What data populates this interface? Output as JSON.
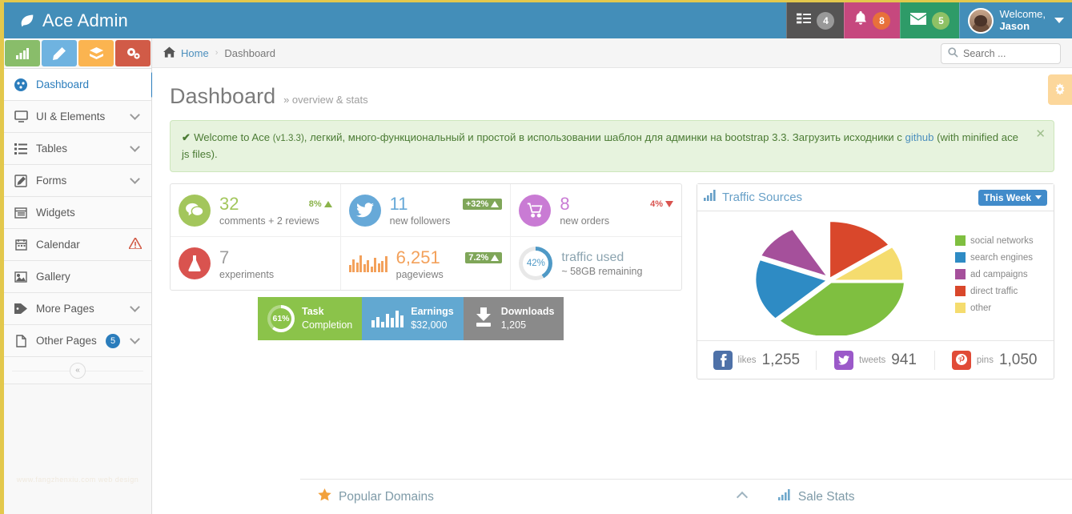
{
  "navbar": {
    "brand": "Ace Admin",
    "brand_icon": "leaf-icon",
    "tasks": {
      "icon": "tasks-icon",
      "count": "4"
    },
    "notifications": {
      "icon": "bell-icon",
      "count": "8"
    },
    "messages": {
      "icon": "envelope-icon",
      "count": "5"
    },
    "user": {
      "greeting": "Welcome,",
      "name": "Jason"
    }
  },
  "sidebar": {
    "shortcuts": [
      {
        "name": "shortcut-chart",
        "icon": "bar-chart-icon",
        "color": "#89BD6A"
      },
      {
        "name": "shortcut-edit",
        "icon": "pencil-icon",
        "color": "#6FB3E0"
      },
      {
        "name": "shortcut-group",
        "icon": "group-icon",
        "color": "#FBB450"
      },
      {
        "name": "shortcut-settings",
        "icon": "cogs-icon",
        "color": "#D15B47"
      }
    ],
    "items": [
      {
        "label": "Dashboard",
        "icon": "dashboard-icon",
        "active": true,
        "caret": false,
        "badge": "",
        "warn": false
      },
      {
        "label": "UI & Elements",
        "icon": "desktop-icon",
        "active": false,
        "caret": true,
        "badge": "",
        "warn": false
      },
      {
        "label": "Tables",
        "icon": "list-icon",
        "active": false,
        "caret": true,
        "badge": "",
        "warn": false
      },
      {
        "label": "Forms",
        "icon": "edit-icon",
        "active": false,
        "caret": true,
        "badge": "",
        "warn": false
      },
      {
        "label": "Widgets",
        "icon": "window-icon",
        "active": false,
        "caret": false,
        "badge": "",
        "warn": false
      },
      {
        "label": "Calendar",
        "icon": "calendar-icon",
        "active": false,
        "caret": false,
        "badge": "",
        "warn": true
      },
      {
        "label": "Gallery",
        "icon": "picture-icon",
        "active": false,
        "caret": false,
        "badge": "",
        "warn": false
      },
      {
        "label": "More Pages",
        "icon": "tag-icon",
        "active": false,
        "caret": true,
        "badge": "",
        "warn": false
      },
      {
        "label": "Other Pages",
        "icon": "file-icon",
        "active": false,
        "caret": true,
        "badge": "5",
        "warn": false
      }
    ],
    "collapse_label": "«",
    "watermark": "www.fangzhenxiu.com web design"
  },
  "breadcrumb": {
    "home": "Home",
    "separator": "›",
    "current": "Dashboard",
    "home_icon": "home-icon"
  },
  "search": {
    "placeholder": "Search ...",
    "value": "",
    "icon": "search-icon"
  },
  "page": {
    "title": "Dashboard",
    "subtitle": "» overview & stats"
  },
  "settings_tab": {
    "icon": "cog-icon"
  },
  "alert": {
    "check": "✔",
    "lead": "Welcome to Ace",
    "version": "(v1.3.3)",
    "text_1": ", легкий, много-функциональный и простой в использовании шаблон для админки на bootstrap 3.3. Загрузить исходники с ",
    "link": "github",
    "text_2": " (with minified ace js files).",
    "close": "✕"
  },
  "tiles": [
    {
      "name": "comments-tile",
      "icon": "comments-icon",
      "color": "#A3C65C",
      "num_class": "green",
      "number": "32",
      "label": "comments + 2 reviews",
      "pct": "8%",
      "pct_style": "plain-green",
      "dir": "up"
    },
    {
      "name": "followers-tile",
      "icon": "twitter-icon",
      "color": "#67A9D8",
      "num_class": "blue",
      "number": "11",
      "label": "new followers",
      "pct": "+32%",
      "pct_style": "chip",
      "dir": "up"
    },
    {
      "name": "orders-tile",
      "icon": "cart-icon",
      "color": "#C97BD4",
      "num_class": "purple",
      "number": "8",
      "label": "new orders",
      "pct": "4%",
      "pct_style": "plain-red",
      "dir": "down"
    },
    {
      "name": "experiments-tile",
      "icon": "flask-icon",
      "color": "#D9534F",
      "num_class": "red",
      "number": "7",
      "label": "experiments",
      "pct": "",
      "pct_style": "",
      "dir": ""
    },
    {
      "name": "pageviews-tile",
      "icon": "sparkline-icon",
      "color": "",
      "num_class": "orange",
      "number": "6,251",
      "label": "pageviews",
      "pct": "7.2%",
      "pct_style": "chip",
      "dir": "up"
    },
    {
      "name": "traffic-tile",
      "icon": "knob-icon",
      "color": "",
      "num_class": "",
      "number": "traffic used",
      "label": "~ 58GB remaining",
      "pct": "42%",
      "pct_style": "",
      "dir": ""
    }
  ],
  "boxes": [
    {
      "name": "task-completion-box",
      "icon": "ring-icon",
      "value": "61%",
      "title": "Task",
      "sub": "Completion",
      "color": "#8BC34A"
    },
    {
      "name": "earnings-box",
      "icon": "bars-icon",
      "value": "",
      "title": "Earnings",
      "sub": "$32,000",
      "color": "#62A8D1"
    },
    {
      "name": "downloads-box",
      "icon": "download-icon",
      "value": "",
      "title": "Downloads",
      "sub": "1,205",
      "color": "#8A8A8A"
    }
  ],
  "traffic": {
    "title": "Traffic Sources",
    "title_icon": "signal-icon",
    "range_label": "This Week",
    "social": [
      {
        "name": "facebook-stat",
        "icon": "facebook-icon",
        "glyph": "f",
        "color": "#4E71A8",
        "label": "likes",
        "value": "1,255"
      },
      {
        "name": "twitter-stat",
        "icon": "twitter-icon",
        "glyph": "t",
        "color": "#9B59C9",
        "label": "tweets",
        "value": "941"
      },
      {
        "name": "pinterest-stat",
        "icon": "pinterest-icon",
        "glyph": "P",
        "color": "#E14B37",
        "label": "pins",
        "value": "1,050"
      }
    ]
  },
  "chart_data": {
    "type": "pie",
    "title": "Traffic Sources",
    "legend_position": "right",
    "labels": [
      "social networks",
      "search engines",
      "ad campaigns",
      "direct traffic",
      "other"
    ],
    "values": [
      38,
      22,
      9,
      20,
      11
    ],
    "colors": [
      "#7FBF40",
      "#2E8BC4",
      "#A5509B",
      "#D9472B",
      "#F5DC6E"
    ]
  },
  "bottom": {
    "popular_domains": {
      "label": "Popular Domains",
      "icon": "star-icon"
    },
    "collapse_icon": "chevron-up-icon",
    "sale_stats": {
      "label": "Sale Stats",
      "icon": "signal-icon"
    }
  }
}
